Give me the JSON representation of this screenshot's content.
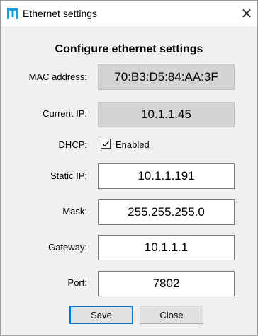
{
  "window": {
    "title": "Ethernet settings",
    "close_symbol": "✕"
  },
  "heading": "Configure ethernet settings",
  "fields": {
    "mac": {
      "label": "MAC address:",
      "value": "70:B3:D5:84:AA:3F"
    },
    "current_ip": {
      "label": "Current IP:",
      "value": "10.1.1.45"
    },
    "dhcp": {
      "label": "DHCP:",
      "checkbox_label": "Enabled",
      "checked": true
    },
    "static_ip": {
      "label": "Static IP:",
      "value": "10.1.1.191"
    },
    "mask": {
      "label": "Mask:",
      "value": "255.255.255.0"
    },
    "gateway": {
      "label": "Gateway:",
      "value": "10.1.1.1"
    },
    "port": {
      "label": "Port:",
      "value": "7802"
    }
  },
  "buttons": {
    "save": "Save",
    "close": "Close"
  },
  "colors": {
    "app_icon": "#1a9be0",
    "focus_border": "#0078d7"
  },
  "icons": {
    "app": "app-logo-icon",
    "close": "close-icon",
    "check": "check-icon"
  }
}
